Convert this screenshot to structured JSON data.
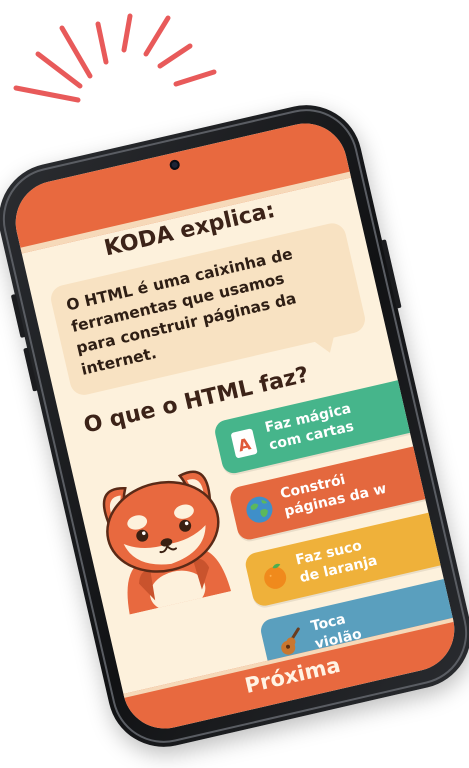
{
  "header": {
    "title": "KODA explica:"
  },
  "explanation": {
    "lines": [
      "O HTML é uma caixinha de",
      "ferramentas que usamos",
      "para construir páginas da",
      "internet."
    ]
  },
  "quiz": {
    "question": "O que o HTML faz?",
    "options": [
      {
        "icon": "letter-a-card-icon",
        "line1": "Faz mágica",
        "line2": "com cartas"
      },
      {
        "icon": "globe-icon",
        "line1": "Constrói",
        "line2": "páginas da w"
      },
      {
        "icon": "orange-icon",
        "line1": "Faz suco",
        "line2": "de laranja"
      },
      {
        "icon": "guitar-icon",
        "line1": "Toca",
        "line2": "violão"
      }
    ]
  },
  "footer": {
    "next_label": "Próxima"
  },
  "colors": {
    "accent": "#e8693f",
    "background": "#fdf1dc",
    "option_green": "#46b58b",
    "option_orange": "#e4683e",
    "option_yellow": "#efb13a",
    "option_blue": "#5a9fbe"
  }
}
